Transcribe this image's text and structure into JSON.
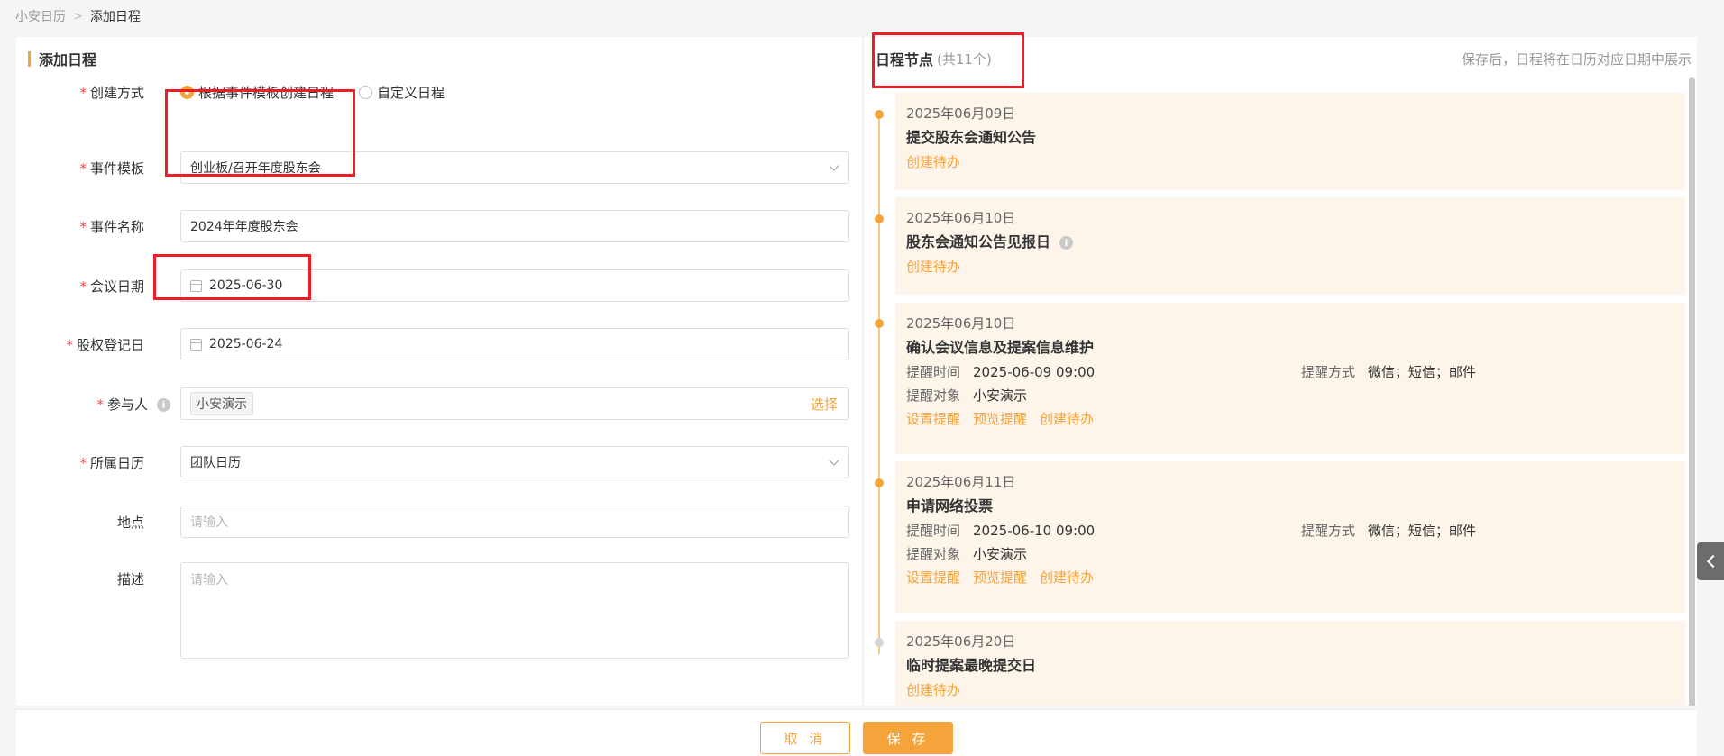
{
  "breadcrumb": {
    "parent": "小安日历",
    "current": "添加日程"
  },
  "left": {
    "title": "添加日程",
    "create_mode": {
      "label": "创建方式",
      "options": [
        "根据事件模板创建日程",
        "自定义日程"
      ],
      "selected": 0
    },
    "template": {
      "label": "事件模板",
      "value": "创业板/召开年度股东会"
    },
    "event_name": {
      "label": "事件名称",
      "value": "2024年年度股东会"
    },
    "meeting_date": {
      "label": "会议日期",
      "value": "2025-06-30"
    },
    "record_date": {
      "label": "股权登记日",
      "value": "2025-06-24"
    },
    "participants": {
      "label": "参与人",
      "tag": "小安演示",
      "action": "选择"
    },
    "calendar": {
      "label": "所属日历",
      "value": "团队日历"
    },
    "location": {
      "label": "地点",
      "placeholder": "请输入"
    },
    "description": {
      "label": "描述",
      "placeholder": "请输入"
    }
  },
  "right": {
    "title": "日程节点",
    "count": "(共11个)",
    "hint": "保存后，日程将在日历对应日期中展示",
    "nodes": [
      {
        "date": "2025年06月09日",
        "name": "提交股东会通知公告",
        "actions": [
          "创建待办"
        ]
      },
      {
        "date": "2025年06月10日",
        "name": "股东会通知公告见报日",
        "actions": [
          "创建待办"
        ]
      },
      {
        "date": "2025年06月10日",
        "name": "确认会议信息及提案信息维护",
        "remind_time_label": "提醒时间",
        "remind_time": "2025-06-09 09:00",
        "remind_way_label": "提醒方式",
        "remind_way": "微信；短信；邮件",
        "remind_target_label": "提醒对象",
        "remind_target": "小安演示",
        "actions": [
          "设置提醒",
          "预览提醒",
          "创建待办"
        ]
      },
      {
        "date": "2025年06月11日",
        "name": "申请网络投票",
        "remind_time_label": "提醒时间",
        "remind_time": "2025-06-10 09:00",
        "remind_way_label": "提醒方式",
        "remind_way": "微信；短信；邮件",
        "remind_target_label": "提醒对象",
        "remind_target": "小安演示",
        "actions": [
          "设置提醒",
          "预览提醒",
          "创建待办"
        ]
      },
      {
        "date": "2025年06月20日",
        "name": "临时提案最晚提交日",
        "actions": [
          "创建待办"
        ]
      }
    ]
  },
  "footer": {
    "cancel": "取 消",
    "save": "保 存"
  },
  "colors": {
    "accent": "#f5a33b",
    "required": "#f5484a",
    "node_bg": "#fef5ea",
    "highlight": "#ee1c25"
  }
}
